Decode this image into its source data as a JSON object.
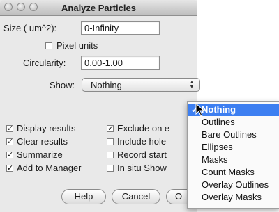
{
  "window": {
    "title": "Analyze Particles"
  },
  "size": {
    "label": "Size ( um^2):",
    "value": "0-Infinity"
  },
  "pixel_units": {
    "label": "Pixel units",
    "checked": false
  },
  "circularity": {
    "label": "Circularity:",
    "value": "0.00-1.00"
  },
  "show": {
    "label": "Show:",
    "value": "Nothing"
  },
  "checkboxes_left": [
    {
      "label": "Display results",
      "checked": true
    },
    {
      "label": "Clear results",
      "checked": true
    },
    {
      "label": "Summarize",
      "checked": true
    },
    {
      "label": "Add to Manager",
      "checked": true
    }
  ],
  "checkboxes_right": [
    {
      "label": "Exclude on e",
      "checked": true
    },
    {
      "label": "Include hole",
      "checked": false
    },
    {
      "label": "Record start",
      "checked": false
    },
    {
      "label": "In situ Show",
      "checked": false
    }
  ],
  "buttons": {
    "help": "Help",
    "cancel": "Cancel",
    "ok": "O"
  },
  "dropdown": {
    "options": [
      "Nothing",
      "Outlines",
      "Bare Outlines",
      "Ellipses",
      "Masks",
      "Count Masks",
      "Overlay Outlines",
      "Overlay Masks"
    ],
    "selected_index": 0,
    "check_glyph": "✓"
  },
  "colors": {
    "highlight": "#3d7ff1"
  }
}
